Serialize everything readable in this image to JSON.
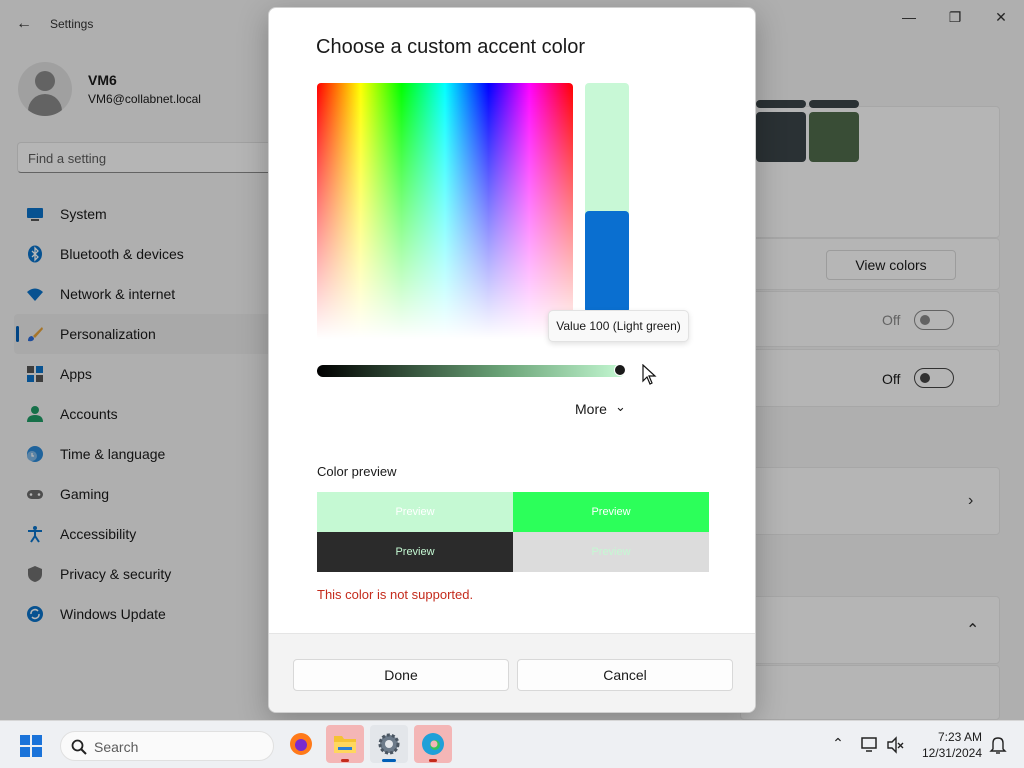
{
  "settings": {
    "app_title": "Settings",
    "user": {
      "name": "VM6",
      "email": "VM6@collabnet.local"
    },
    "search_placeholder": "Find a setting",
    "nav": [
      {
        "label": "System",
        "icon": "monitor-icon"
      },
      {
        "label": "Bluetooth & devices",
        "icon": "bluetooth-icon"
      },
      {
        "label": "Network & internet",
        "icon": "wifi-icon"
      },
      {
        "label": "Personalization",
        "icon": "brush-icon",
        "active": true
      },
      {
        "label": "Apps",
        "icon": "apps-icon"
      },
      {
        "label": "Accounts",
        "icon": "person-icon"
      },
      {
        "label": "Time & language",
        "icon": "clock-globe-icon"
      },
      {
        "label": "Gaming",
        "icon": "gamepad-icon"
      },
      {
        "label": "Accessibility",
        "icon": "accessibility-icon"
      },
      {
        "label": "Privacy & security",
        "icon": "shield-icon"
      },
      {
        "label": "Windows Update",
        "icon": "update-icon"
      }
    ],
    "view_colors_label": "View colors",
    "toggle_1_state": "Off",
    "toggle_2_state": "Off",
    "swatch_colors": [
      "#3b4448",
      "#4f6b4b"
    ]
  },
  "dialog": {
    "title": "Choose a custom accent color",
    "tooltip": "Value 100 (Light green)",
    "value_level_percent": 100,
    "more_label": "More",
    "color_preview_label": "Color preview",
    "preview_cells": [
      {
        "text": "Preview",
        "bg": "#c5f9d3",
        "fg": "#ffffff"
      },
      {
        "text": "Preview",
        "bg": "#2cff5a",
        "fg": "#ffffff"
      },
      {
        "text": "Preview",
        "bg": "#2b2b2b",
        "fg": "#c5f9d3"
      },
      {
        "text": "Preview",
        "bg": "#dcdcdc",
        "fg": "#c5f9d3"
      }
    ],
    "error_message": "This color is not supported.",
    "done_label": "Done",
    "cancel_label": "Cancel"
  },
  "taskbar": {
    "search_label": "Search",
    "time": "7:23 AM",
    "date": "12/31/2024"
  }
}
